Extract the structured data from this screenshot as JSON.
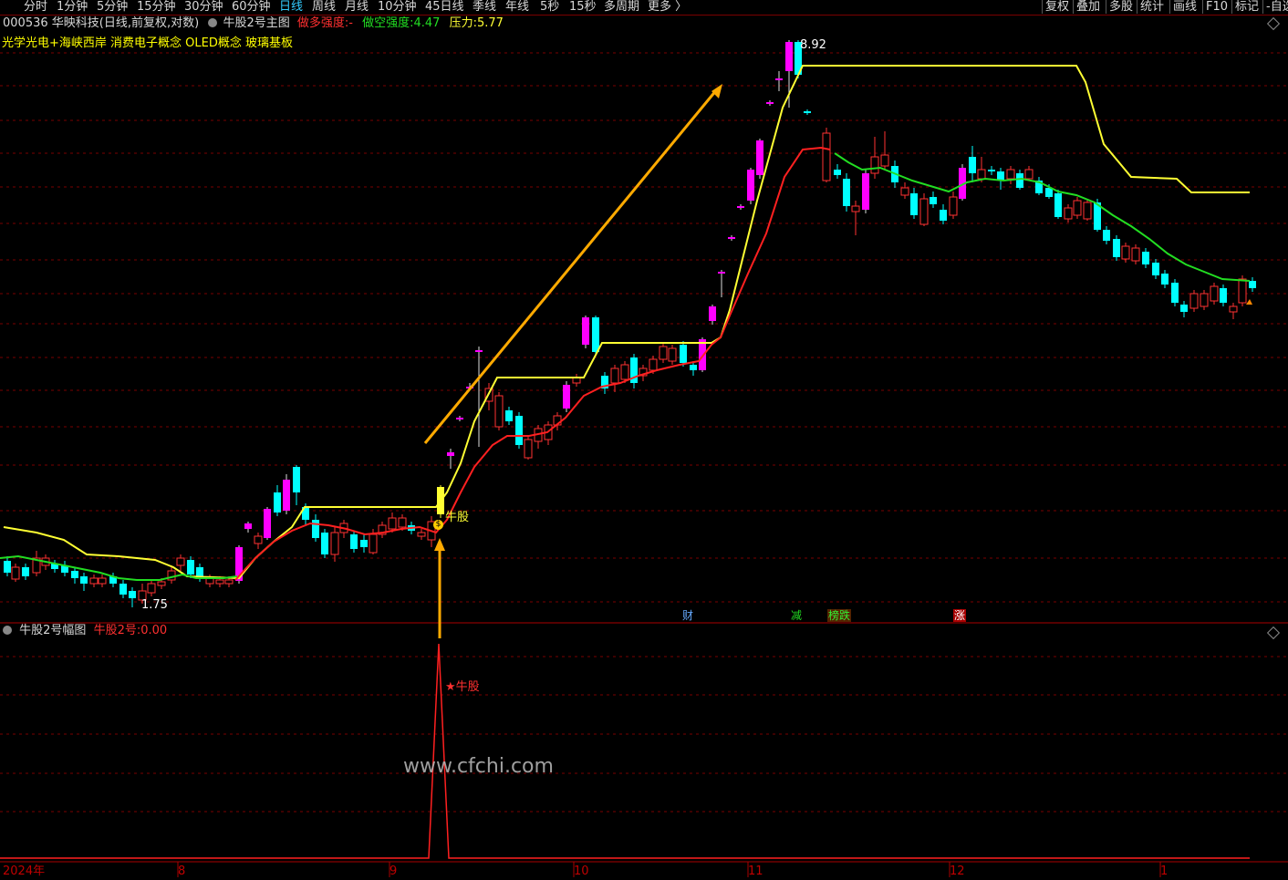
{
  "toolbar": {
    "periods": [
      "分时",
      "1分钟",
      "5分钟",
      "15分钟",
      "30分钟",
      "60分钟",
      "日线",
      "周线",
      "月线",
      "10分钟",
      "45日线",
      "季线",
      "年线",
      "5秒",
      "15秒",
      "多周期",
      "更多 〉"
    ],
    "active_period": "日线",
    "right_buttons": [
      "复权",
      "叠加",
      "多股",
      "统计",
      "画线",
      "F10",
      "标记",
      "-自选"
    ]
  },
  "header": {
    "stock": "000536 华映科技(日线,前复权,对数)",
    "main_indicator": "牛股2号主图",
    "bull_strength_label": "做多强度:",
    "bull_strength_value": "-",
    "bear_strength_label": "做空强度:",
    "bear_strength_value": "4.47",
    "pressure_label": "压力:",
    "pressure_value": "5.77",
    "concepts": "光学光电+海峡西岸 消费电子概念 OLED概念 玻璃基板"
  },
  "annotations": {
    "high_label": "8.92",
    "low_label": "1.75",
    "signal_label": "牛股",
    "star_label": "★牛股",
    "events": [
      "财",
      "减",
      "榜跌",
      "涨"
    ]
  },
  "indicator": {
    "title": "牛股2号幅图",
    "value_label": "牛股2号:",
    "value": "0.00"
  },
  "xaxis": [
    "2024年",
    "8",
    "9",
    "10",
    "11",
    "12",
    "1"
  ],
  "watermark": "www.cfchi.com",
  "colors": {
    "up": "#ff3232",
    "down": "#00ffff",
    "bull": "#ff00ff",
    "ma_red": "#ff2020",
    "ma_green": "#22dd22",
    "pressure": "#ffff33",
    "arrow": "#ffaa00",
    "grid": "#7a0000"
  }
}
